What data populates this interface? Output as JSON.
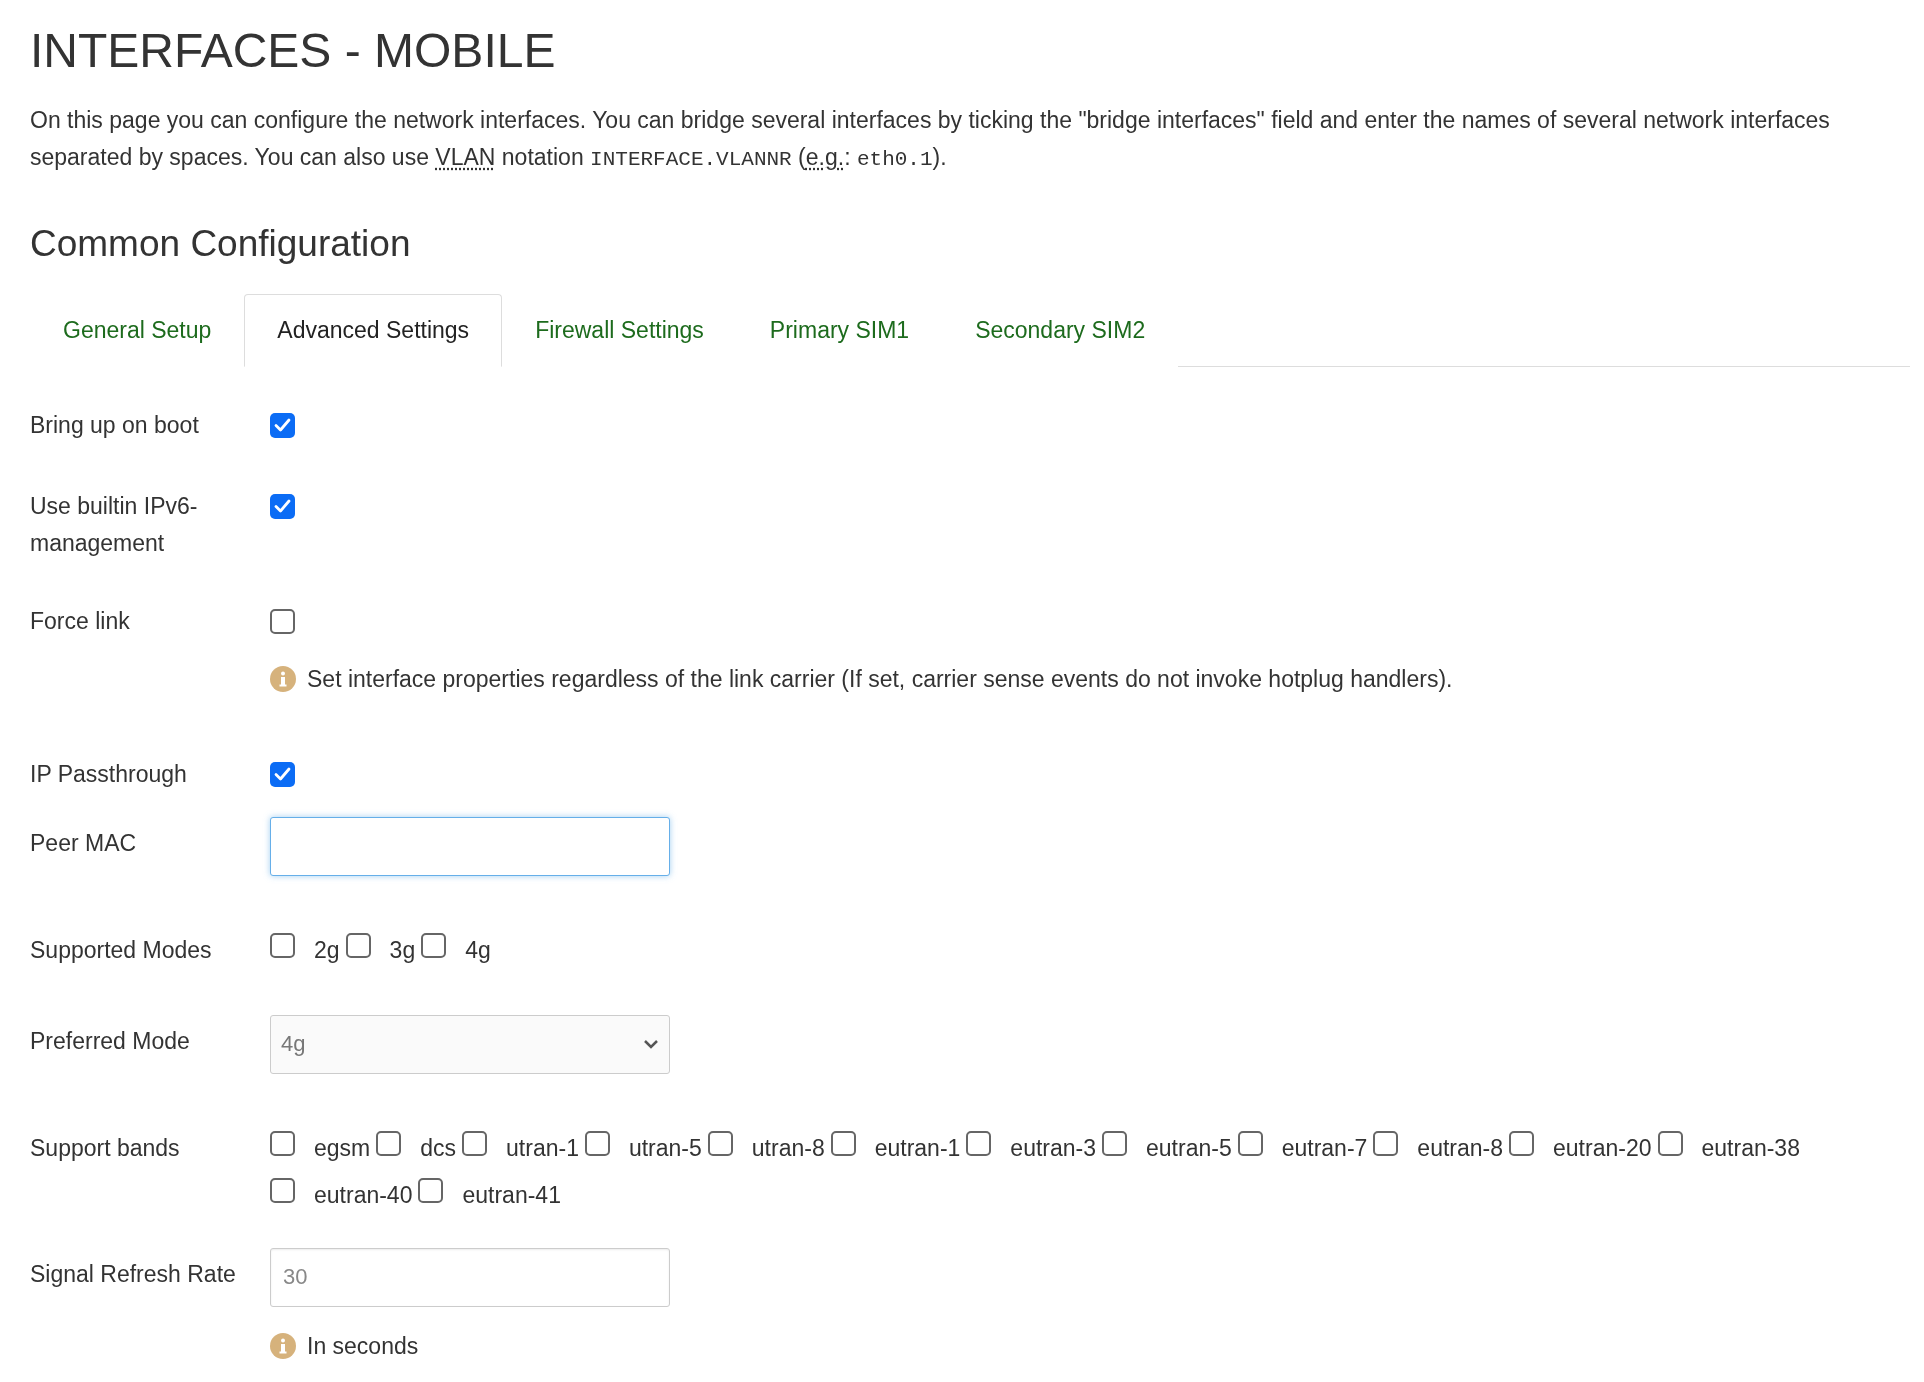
{
  "page_title": "INTERFACES - MOBILE",
  "description": [
    {
      "kind": "text",
      "text": "On this page you can configure the network interfaces. You can bridge several interfaces by ticking the \"bridge interfaces\" field and enter the names of several network interfaces separated by spaces. You can also use "
    },
    {
      "kind": "abbr",
      "text": "VLAN"
    },
    {
      "kind": "text",
      "text": " notation "
    },
    {
      "kind": "code",
      "text": "INTERFACE.VLANNR"
    },
    {
      "kind": "text",
      "text": " ("
    },
    {
      "kind": "abbr",
      "text": "e.g."
    },
    {
      "kind": "text",
      "text": ": "
    },
    {
      "kind": "code",
      "text": "eth0.1"
    },
    {
      "kind": "text",
      "text": ")."
    }
  ],
  "section_title": "Common Configuration",
  "tabs": [
    {
      "label": "General Setup",
      "selected": false
    },
    {
      "label": "Advanced Settings",
      "selected": true
    },
    {
      "label": "Firewall Settings",
      "selected": false
    },
    {
      "label": "Primary SIM1",
      "selected": false
    },
    {
      "label": "Secondary SIM2",
      "selected": false
    }
  ],
  "fields": [
    {
      "kind": "checkbox",
      "label": "Bring up on boot",
      "checked": true
    },
    {
      "kind": "checkbox",
      "label": "Use builtin IPv6-management",
      "checked": true
    },
    {
      "kind": "checkbox",
      "label": "Force link",
      "checked": false,
      "help": "Set interface properties regardless of the link carrier (If set, carrier sense events do not invoke hotplug handlers)."
    },
    {
      "kind": "checkbox",
      "label": "IP Passthrough",
      "checked": true
    },
    {
      "kind": "text",
      "label": "Peer MAC",
      "focused": true
    },
    {
      "kind": "multi",
      "label": "Supported Modes",
      "options": [
        {
          "label": "2g",
          "checked": false
        },
        {
          "label": "3g",
          "checked": false
        },
        {
          "label": "4g",
          "checked": false
        }
      ]
    },
    {
      "kind": "select",
      "label": "Preferred Mode",
      "value": "4g"
    },
    {
      "kind": "multi",
      "label": "Support bands",
      "options": [
        {
          "label": "egsm",
          "checked": false
        },
        {
          "label": "dcs",
          "checked": false
        },
        {
          "label": "utran-1",
          "checked": false
        },
        {
          "label": "utran-5",
          "checked": false
        },
        {
          "label": "utran-8",
          "checked": false
        },
        {
          "label": "eutran-1",
          "checked": false
        },
        {
          "label": "eutran-3",
          "checked": false
        },
        {
          "label": "eutran-5",
          "checked": false
        },
        {
          "label": "eutran-7",
          "checked": false
        },
        {
          "label": "eutran-8",
          "checked": false
        },
        {
          "label": "eutran-20",
          "checked": false
        },
        {
          "label": "eutran-38",
          "checked": false
        },
        {
          "label": "eutran-40",
          "checked": false
        },
        {
          "label": "eutran-41",
          "checked": false
        }
      ]
    },
    {
      "kind": "text",
      "label": "Signal Refresh Rate",
      "placeholder": "30",
      "focused": false,
      "help": "In seconds"
    }
  ]
}
